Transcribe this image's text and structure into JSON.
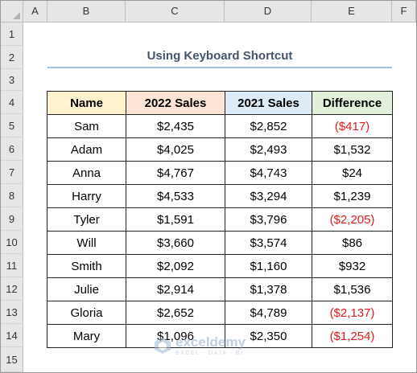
{
  "columns": [
    "A",
    "B",
    "C",
    "D",
    "E",
    "F"
  ],
  "rows": [
    "1",
    "2",
    "3",
    "4",
    "5",
    "6",
    "7",
    "8",
    "9",
    "10",
    "11",
    "12",
    "13",
    "14",
    "15"
  ],
  "title": "Using Keyboard Shortcut",
  "table": {
    "headers": [
      "Name",
      "2022 Sales",
      "2021 Sales",
      "Difference"
    ],
    "rows": [
      {
        "name": "Sam",
        "s2022": "$2,435",
        "s2021": "$2,852",
        "diff": "($417)",
        "negative": true
      },
      {
        "name": "Adam",
        "s2022": "$4,025",
        "s2021": "$2,493",
        "diff": "$1,532",
        "negative": false
      },
      {
        "name": "Anna",
        "s2022": "$4,767",
        "s2021": "$4,743",
        "diff": "$24",
        "negative": false
      },
      {
        "name": "Harry",
        "s2022": "$4,533",
        "s2021": "$3,294",
        "diff": "$1,239",
        "negative": false
      },
      {
        "name": "Tyler",
        "s2022": "$1,591",
        "s2021": "$3,796",
        "diff": "($2,205)",
        "negative": true
      },
      {
        "name": "Will",
        "s2022": "$3,660",
        "s2021": "$3,574",
        "diff": "$86",
        "negative": false
      },
      {
        "name": "Smith",
        "s2022": "$2,092",
        "s2021": "$1,160",
        "diff": "$932",
        "negative": false
      },
      {
        "name": "Julie",
        "s2022": "$2,914",
        "s2021": "$1,378",
        "diff": "$1,536",
        "negative": false
      },
      {
        "name": "Gloria",
        "s2022": "$2,652",
        "s2021": "$4,789",
        "diff": "($2,137)",
        "negative": true
      },
      {
        "name": "Mary",
        "s2022": "$1,096",
        "s2021": "$2,350",
        "diff": "($1,254)",
        "negative": true
      }
    ]
  },
  "watermark": {
    "name": "exceldemy",
    "tagline": "EXCEL · DATA · BI"
  },
  "colors": {
    "name_header": "#fff2cc",
    "sales2022_header": "#fce4d6",
    "sales2021_header": "#ddebf7",
    "difference_header": "#e2efda",
    "negative": "#e01b1b",
    "title_rule": "#9dc3e6"
  }
}
